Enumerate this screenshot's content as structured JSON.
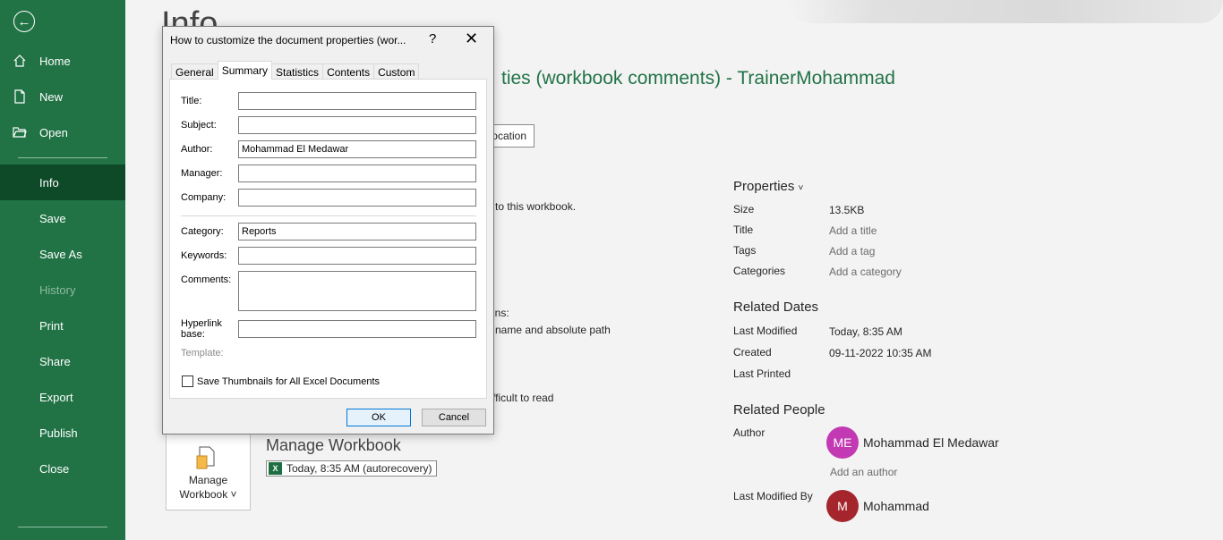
{
  "nav": {
    "items": [
      {
        "label": "Home"
      },
      {
        "label": "New"
      },
      {
        "label": "Open"
      },
      {
        "label": "Info"
      },
      {
        "label": "Save"
      },
      {
        "label": "Save As"
      },
      {
        "label": "History"
      },
      {
        "label": "Print"
      },
      {
        "label": "Share"
      },
      {
        "label": "Export"
      },
      {
        "label": "Publish"
      },
      {
        "label": "Close"
      }
    ]
  },
  "main": {
    "page_title": "Info",
    "doc_heading": "ties (workbook comments) - TrainerMohammad",
    "open_location_label": "ocation",
    "fragments": {
      "to_this_workbook": "to this workbook.",
      "ins": "ins:",
      "name_path": "name and absolute path",
      "difficult": "fficult to read"
    },
    "properties": {
      "heading": "Properties",
      "rows": [
        {
          "label": "Size",
          "value": "13.5KB"
        },
        {
          "label": "Title",
          "value": "Add a title"
        },
        {
          "label": "Tags",
          "value": "Add a tag"
        },
        {
          "label": "Categories",
          "value": "Add a category"
        }
      ]
    },
    "related_dates": {
      "heading": "Related Dates",
      "rows": [
        {
          "label": "Last Modified",
          "value": "Today, 8:35 AM"
        },
        {
          "label": "Created",
          "value": "09-11-2022 10:35 AM"
        },
        {
          "label": "Last Printed",
          "value": ""
        }
      ]
    },
    "related_people": {
      "heading": "Related People",
      "author_label": "Author",
      "author_initials": "ME",
      "author_name": "Mohammad El Medawar",
      "author_color": "#c239b3",
      "add_author": "Add an author",
      "last_modified_by_label": "Last Modified By",
      "modifier_initials": "M",
      "modifier_name": "Mohammad",
      "modifier_color": "#a4262c"
    },
    "manage": {
      "button_line1": "Manage",
      "button_line2": "Workbook ˅",
      "title": "Manage Workbook",
      "autorecovery": "Today, 8:35 AM (autorecovery)"
    }
  },
  "dialog": {
    "title": "How to customize the document properties (wor...",
    "help": "?",
    "close": "✕",
    "tabs": [
      "General",
      "Summary",
      "Statistics",
      "Contents",
      "Custom"
    ],
    "fields": {
      "title_label": "Title:",
      "title_value": "",
      "subject_label": "Subject:",
      "subject_value": "",
      "author_label": "Author:",
      "author_value": "Mohammad El Medawar",
      "manager_label": "Manager:",
      "manager_value": "",
      "company_label": "Company:",
      "company_value": "",
      "category_label": "Category:",
      "category_value": "Reports",
      "keywords_label": "Keywords:",
      "keywords_value": "",
      "comments_label": "Comments:",
      "comments_value": "",
      "hyperlink_label_1": "Hyperlink",
      "hyperlink_label_2": "base:",
      "hyperlink_value": "",
      "template_label": "Template:"
    },
    "save_thumbnails": "Save Thumbnails for All Excel Documents",
    "ok": "OK",
    "cancel": "Cancel"
  }
}
